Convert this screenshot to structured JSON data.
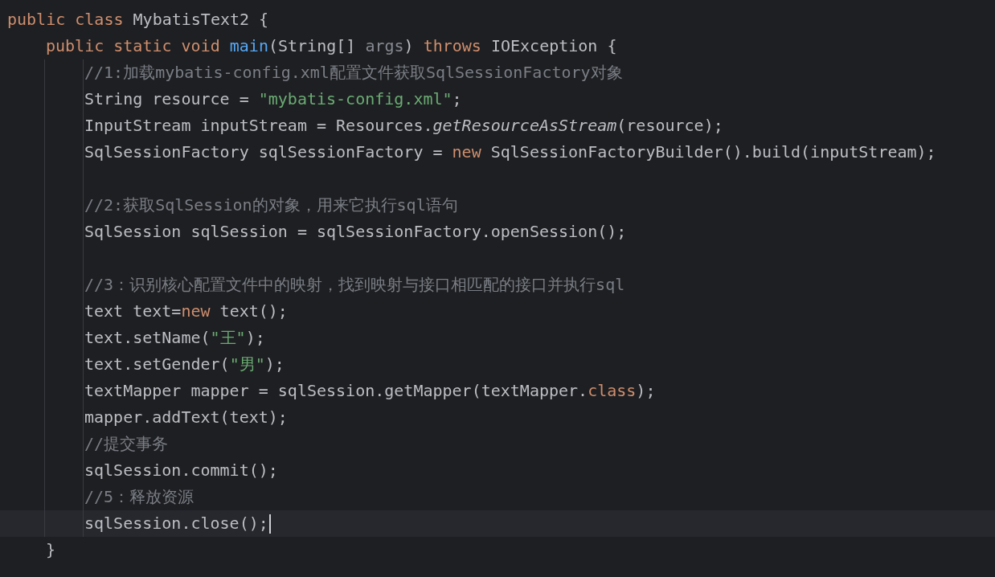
{
  "lines": [
    {
      "current": false,
      "tokens": [
        {
          "kind": "keyword",
          "text": "public class "
        },
        {
          "kind": "plain",
          "text": "MybatisText2 {"
        }
      ],
      "children": [
        {
          "current": false,
          "tokens": [
            {
              "kind": "keyword",
              "text": "public static void "
            },
            {
              "kind": "declaration",
              "text": "main"
            },
            {
              "kind": "plain",
              "text": "(String[] "
            },
            {
              "kind": "parameter",
              "text": "args"
            },
            {
              "kind": "plain",
              "text": ") "
            },
            {
              "kind": "keyword",
              "text": "throws "
            },
            {
              "kind": "plain",
              "text": "IOException {"
            }
          ],
          "children": [
            {
              "current": false,
              "tokens": [
                {
                  "kind": "comment",
                  "text": "//1:加载mybatis-config.xml配置文件获取SqlSessionFactory对象"
                }
              ]
            },
            {
              "current": false,
              "tokens": [
                {
                  "kind": "plain",
                  "text": "String resource = "
                },
                {
                  "kind": "string",
                  "text": "\"mybatis-config.xml\""
                },
                {
                  "kind": "plain",
                  "text": ";"
                }
              ]
            },
            {
              "current": false,
              "tokens": [
                {
                  "kind": "plain",
                  "text": "InputStream inputStream = Resources."
                },
                {
                  "kind": "static-call",
                  "text": "getResourceAsStream"
                },
                {
                  "kind": "plain",
                  "text": "(resource);"
                }
              ]
            },
            {
              "current": false,
              "tokens": [
                {
                  "kind": "plain",
                  "text": "SqlSessionFactory sqlSessionFactory = "
                },
                {
                  "kind": "keyword",
                  "text": "new "
                },
                {
                  "kind": "plain",
                  "text": "SqlSessionFactoryBuilder().build(inputStream);"
                }
              ]
            },
            {
              "current": false
            },
            {
              "current": false,
              "tokens": [
                {
                  "kind": "comment",
                  "text": "//2:获取SqlSession的对象，用来它执行sql语句"
                }
              ]
            },
            {
              "current": false,
              "tokens": [
                {
                  "kind": "plain",
                  "text": "SqlSession sqlSession = sqlSessionFactory.openSession();"
                }
              ]
            },
            {
              "current": false
            },
            {
              "current": false,
              "tokens": [
                {
                  "kind": "comment",
                  "text": "//3：识别核心配置文件中的映射，找到映射与接口相匹配的接口并执行sql"
                }
              ]
            },
            {
              "current": false,
              "tokens": [
                {
                  "kind": "plain",
                  "text": "text text="
                },
                {
                  "kind": "keyword",
                  "text": "new "
                },
                {
                  "kind": "plain",
                  "text": "text();"
                }
              ]
            },
            {
              "current": false,
              "tokens": [
                {
                  "kind": "plain",
                  "text": "text.setName("
                },
                {
                  "kind": "string",
                  "text": "\"王\""
                },
                {
                  "kind": "plain",
                  "text": ");"
                }
              ]
            },
            {
              "current": false,
              "tokens": [
                {
                  "kind": "plain",
                  "text": "text.setGender("
                },
                {
                  "kind": "string",
                  "text": "\"男\""
                },
                {
                  "kind": "plain",
                  "text": ");"
                }
              ]
            },
            {
              "current": false,
              "tokens": [
                {
                  "kind": "plain",
                  "text": "textMapper mapper = sqlSession.getMapper(textMapper."
                },
                {
                  "kind": "keyword",
                  "text": "class"
                },
                {
                  "kind": "plain",
                  "text": ");"
                }
              ]
            },
            {
              "current": false,
              "tokens": [
                {
                  "kind": "plain",
                  "text": "mapper.addText(text);"
                }
              ]
            },
            {
              "current": false,
              "tokens": [
                {
                  "kind": "comment",
                  "text": "//提交事务"
                }
              ]
            },
            {
              "current": false,
              "tokens": [
                {
                  "kind": "plain",
                  "text": "sqlSession.commit();"
                }
              ]
            },
            {
              "current": false,
              "tokens": [
                {
                  "kind": "comment",
                  "text": "//5：释放资源"
                }
              ]
            },
            {
              "current": true,
              "tokens": [
                {
                  "kind": "plain",
                  "text": "sqlSession.close();"
                }
              ]
            }
          ]
        },
        {
          "current": false,
          "tokens": [
            {
              "kind": "plain",
              "text": "}"
            }
          ]
        }
      ]
    }
  ]
}
